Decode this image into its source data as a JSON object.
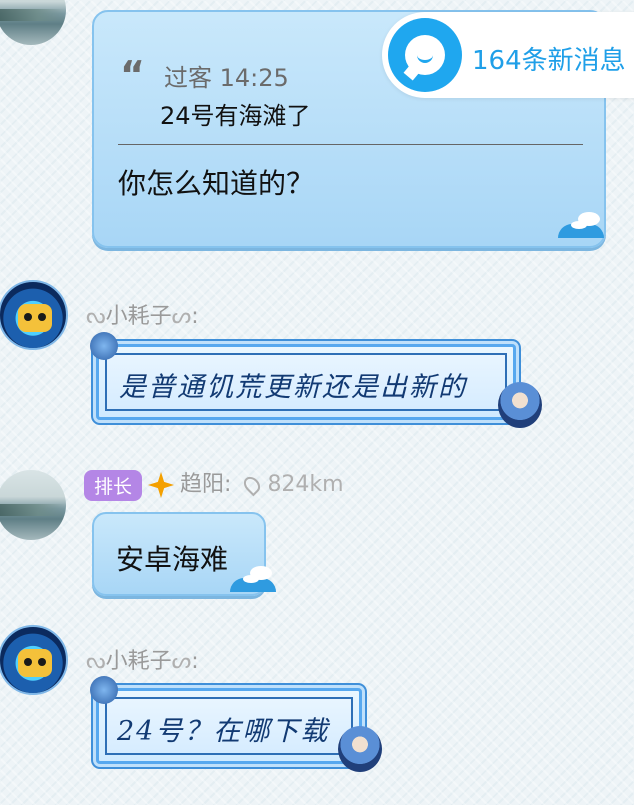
{
  "new_messages": {
    "label": "164条新消息"
  },
  "quote_message": {
    "quoted_user": "过客",
    "quoted_time": "14:25",
    "quoted_text": "24号有海滩了",
    "reply_text": "你怎么知道的？"
  },
  "messages": [
    {
      "sender_name": "小耗子",
      "sender_suffix": ":",
      "text": "是普通饥荒更新还是出新的"
    },
    {
      "badge": "排长",
      "sender_name": "趋阳:",
      "distance": "824km",
      "text": "安卓海难"
    },
    {
      "sender_name": "小耗子",
      "sender_suffix": ":",
      "text": "24号？在哪下载"
    }
  ],
  "colors": {
    "accent": "#1fa7ef",
    "bubble": "#a8d6f6",
    "badge": "#b486e6",
    "star": "#f4a000"
  },
  "icons": {
    "message_bubble": "chat-bubble-icon",
    "quote": "quote-mark-icon",
    "location": "location-pin-icon",
    "rank_star": "star-badge-icon"
  }
}
